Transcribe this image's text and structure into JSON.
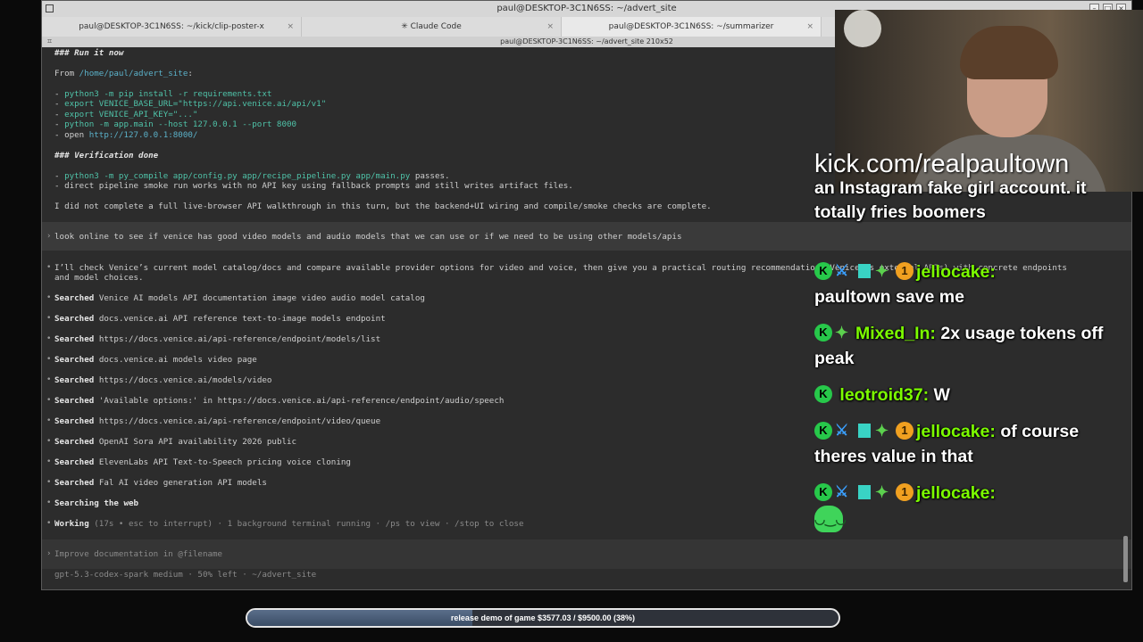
{
  "window": {
    "title": "paul@DESKTOP-3C1N6SS: ~/advert_site",
    "size_label": "paul@DESKTOP-3C1N6SS: ~/advert_site 210x52",
    "tabs": [
      {
        "label": "paul@DESKTOP-3C1N6SS: ~/kick/clip-poster-x"
      },
      {
        "label": "✳ Claude Code"
      },
      {
        "label": "paul@DESKTOP-3C1N6SS: ~/summarizer"
      }
    ]
  },
  "terminal": {
    "run_heading": "### Run it now",
    "from_label": "From ",
    "from_path": "/home/paul/advert_site",
    "from_colon": ":",
    "run_steps": [
      {
        "prefix": "- ",
        "code": "python3 -m pip install -r requirements.txt"
      },
      {
        "prefix": "- ",
        "code": "export VENICE_BASE_URL=\"https://api.venice.ai/api/v1\""
      },
      {
        "prefix": "- ",
        "code": "export VENICE_API_KEY=\"...\""
      },
      {
        "prefix": "- ",
        "code": "python -m app.main --host 127.0.0.1 --port 8000"
      },
      {
        "prefix": "- open ",
        "code": "http://127.0.0.1:8000/"
      }
    ],
    "verify_heading": "### Verification done",
    "verify_1_prefix": "- ",
    "verify_1_code": "python3 -m py_compile app/config.py app/recipe_pipeline.py app/main.py",
    "verify_1_suffix": " passes.",
    "verify_2": "- direct pipeline smoke run works with no API key using fallback prompts and still writes artifact files.",
    "note": "I did not complete a full live-browser API walkthrough in this turn, but the backend+UI wiring and compile/smoke checks are complete.",
    "user_prompt": "look online to see if venice has good video models and audio models that we can use or if we need to be using other models/apis",
    "reply_1": "I’ll check Venice’s current model catalog/docs and compare available provider options for video and voice, then give you a practical routing recommendation (Venice vs external APIs) with concrete endpoints",
    "reply_2": "and model choices.",
    "searched_label": "Searched",
    "searches": [
      "Venice AI models API documentation image video audio model catalog",
      "docs.venice.ai API reference text-to-image models endpoint",
      "https://docs.venice.ai/api-reference/endpoint/models/list",
      "docs.venice.ai models video page",
      "https://docs.venice.ai/models/video",
      "'Available options:' in https://docs.venice.ai/api-reference/endpoint/audio/speech",
      "https://docs.venice.ai/api-reference/endpoint/video/queue",
      "OpenAI Sora API availability 2026 public",
      "ElevenLabs API Text-to-Speech pricing voice cloning",
      "Fal AI video generation API models"
    ],
    "searching": "Searching the web",
    "working_word": "Working",
    "working_status": " (17s • esc to interrupt) · 1 background terminal running · /ps to view · /stop to close",
    "input_placeholder": "Improve documentation in @filename",
    "footer": "gpt-5.3-codex-spark medium · 50% left · ~/advert_site"
  },
  "stream": {
    "watermark": "kick.com/realpaultown",
    "chat": [
      {
        "name": "",
        "text": "an Instagram fake girl account. it totally fries boomers"
      },
      {
        "name": "jellocake:",
        "text": "paultown save me"
      },
      {
        "name": "Mixed_In:",
        "text": "2x usage tokens off peak"
      },
      {
        "name": "leotroid37:",
        "text": "W"
      },
      {
        "name": "jellocake:",
        "text": "of course theres value in that"
      },
      {
        "name": "jellocake:",
        "text": ""
      }
    ],
    "emote_name": "emote",
    "progress": {
      "label": "release demo of game $3577.03 / $9500.00 (38%)",
      "fraction": 0.38
    }
  }
}
